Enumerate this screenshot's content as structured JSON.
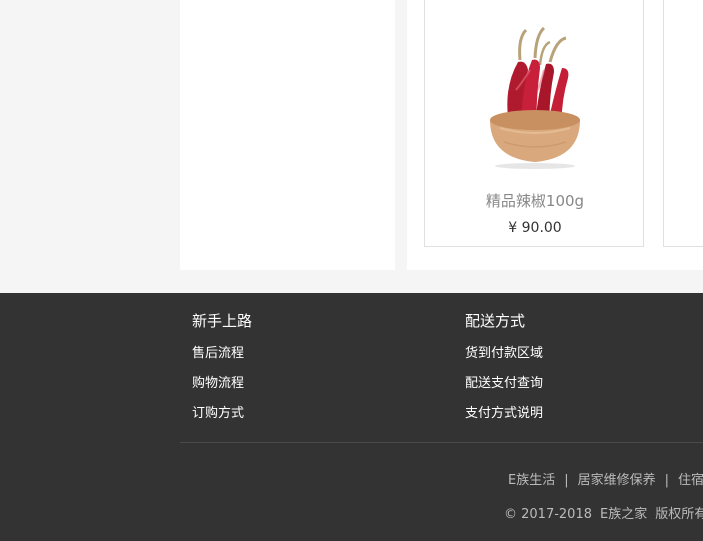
{
  "products": [
    {
      "name": "精品辣椒100g",
      "price": "¥ 90.00",
      "image_icon": "chili-pepper-bowl-image"
    }
  ],
  "footer": {
    "columns": [
      {
        "title": "新手上路",
        "links": [
          "售后流程",
          "购物流程",
          "订购方式"
        ]
      },
      {
        "title": "配送方式",
        "links": [
          "货到付款区域",
          "配送支付查询",
          "支付方式说明"
        ]
      }
    ],
    "bottom_links": [
      "E族生活",
      "居家维修保养",
      "住宿"
    ],
    "separator": "|",
    "copyright": {
      "symbol": "© 2017-2018",
      "brand": "E族之家",
      "rights": "版权所有"
    }
  },
  "colors": {
    "footer_bg": "#333333",
    "page_bg": "#f5f5f5",
    "product_name": "#888888",
    "price": "#333333"
  }
}
